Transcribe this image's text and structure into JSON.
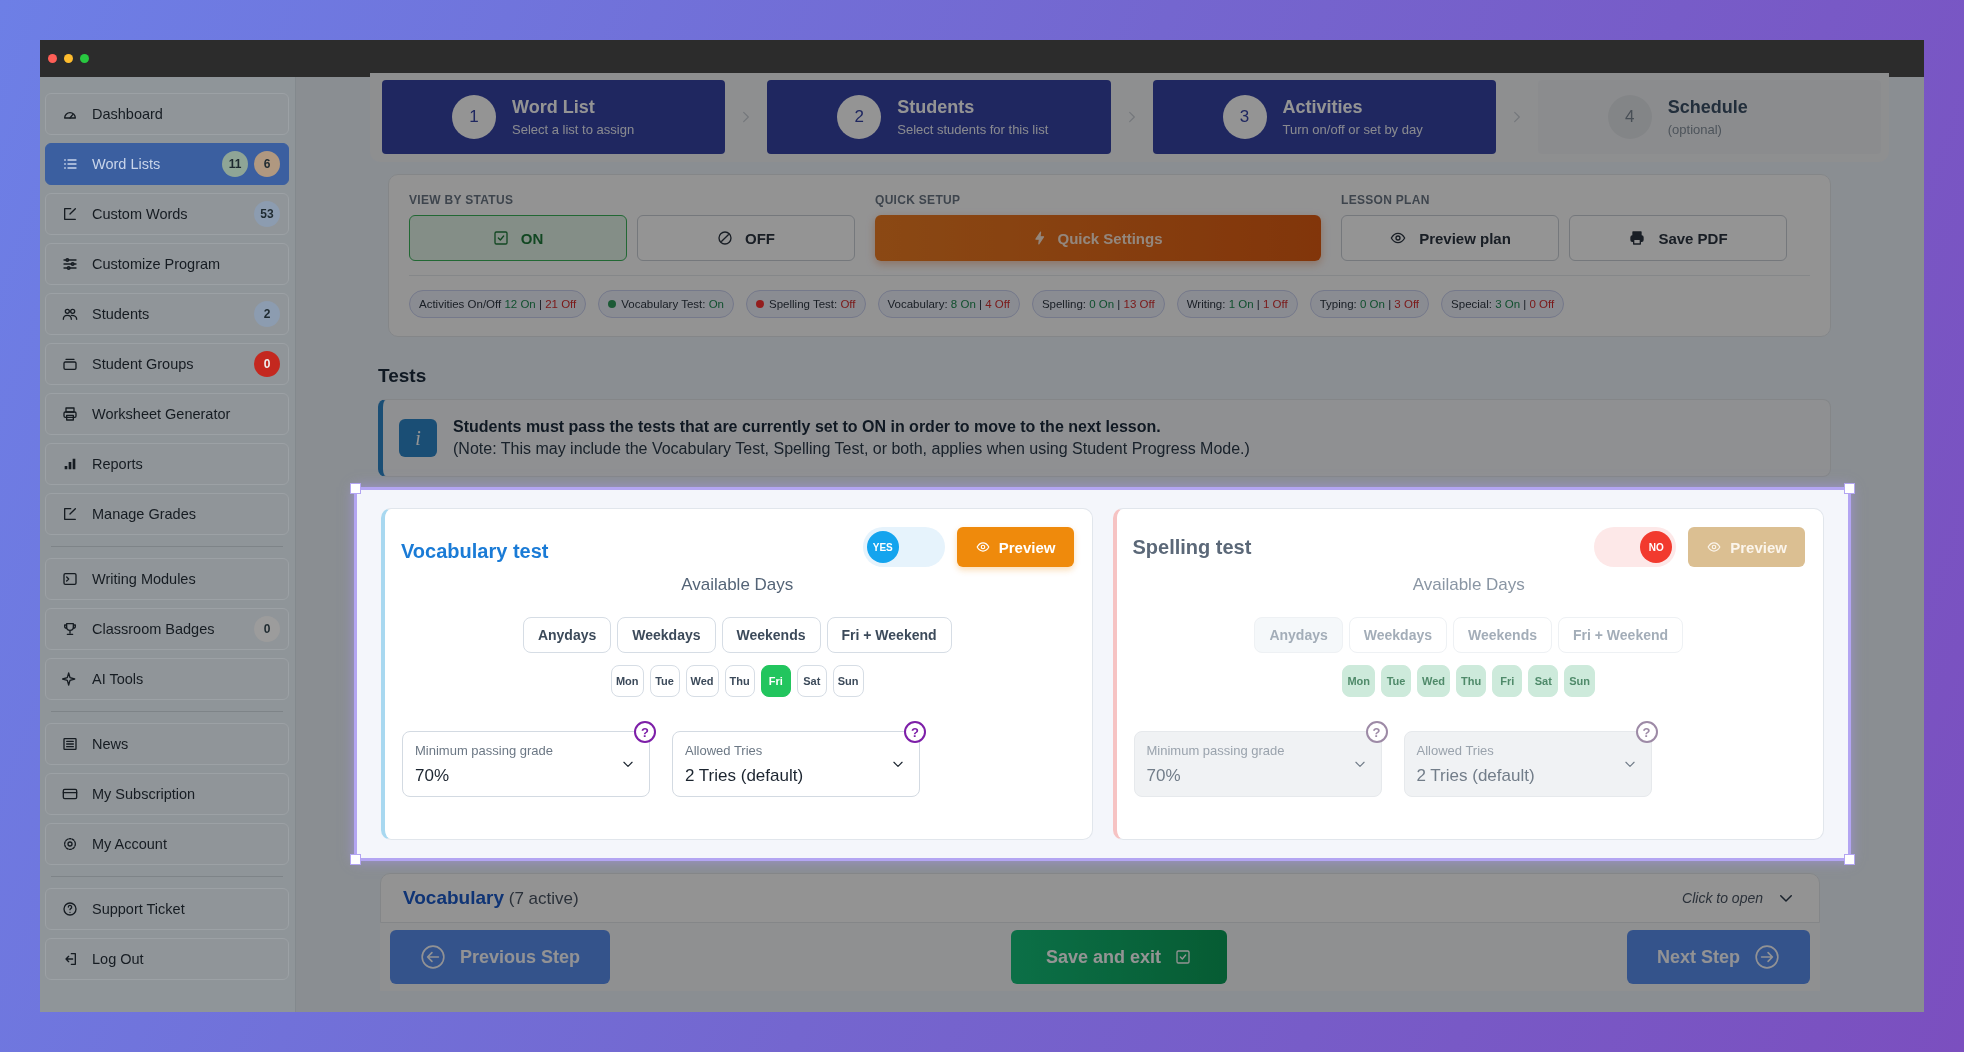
{
  "sidebar": {
    "items": [
      {
        "label": "Dashboard",
        "selected": false
      },
      {
        "label": "Word Lists",
        "selected": true,
        "badges": [
          {
            "text": "11",
            "color": "#8fa596"
          },
          {
            "text": "6",
            "color": "#b09880"
          }
        ]
      },
      {
        "label": "Custom Words",
        "selected": false,
        "badges": [
          {
            "text": "53",
            "color": "#8c9cb0"
          }
        ]
      },
      {
        "label": "Customize Program",
        "selected": false
      },
      {
        "label": "Students",
        "selected": false,
        "badges": [
          {
            "text": "2",
            "color": "#8c9cb0"
          }
        ]
      },
      {
        "label": "Student Groups",
        "selected": false,
        "badges": [
          {
            "text": "0",
            "color": "#c4281f"
          }
        ]
      },
      {
        "label": "Worksheet Generator",
        "selected": false
      },
      {
        "label": "Reports",
        "selected": false
      },
      {
        "label": "Manage Grades",
        "selected": false,
        "divider_after": true
      },
      {
        "label": "Writing Modules",
        "selected": false
      },
      {
        "label": "Classroom Badges",
        "selected": false,
        "badges": [
          {
            "text": "0",
            "color": "#9c9c9c"
          }
        ]
      },
      {
        "label": "AI Tools",
        "selected": false,
        "divider_after": true
      },
      {
        "label": "News",
        "selected": false
      },
      {
        "label": "My Subscription",
        "selected": false
      },
      {
        "label": "My Account",
        "selected": false,
        "divider_after": true
      },
      {
        "label": "Support Ticket",
        "selected": false
      },
      {
        "label": "Log Out",
        "selected": false
      }
    ]
  },
  "steps": [
    {
      "number": "1",
      "title": "Word List",
      "subtitle": "Select a list to assign",
      "active": true
    },
    {
      "number": "2",
      "title": "Students",
      "subtitle": "Select students for this list",
      "active": true
    },
    {
      "number": "3",
      "title": "Activities",
      "subtitle": "Turn on/off or set by day",
      "active": true
    },
    {
      "number": "4",
      "title": "Schedule",
      "subtitle": "(optional)",
      "active": false
    }
  ],
  "toolbar": {
    "view_by_status": {
      "heading": "VIEW BY STATUS",
      "buttons": [
        {
          "label": "ON",
          "selected": true
        },
        {
          "label": "OFF",
          "selected": false
        }
      ]
    },
    "quick_setup": {
      "heading": "QUICK SETUP",
      "button": "Quick Settings"
    },
    "lesson_plan": {
      "heading": "LESSON PLAN",
      "buttons": [
        "Preview plan",
        "Save PDF"
      ]
    },
    "chips": [
      {
        "label": "Activities On/Off",
        "parts": [
          {
            "text": "12 On",
            "kind": "on"
          },
          {
            "text": "|",
            "kind": "sep"
          },
          {
            "text": "21 Off",
            "kind": "off"
          }
        ]
      },
      {
        "label": "Vocabulary Test:",
        "color": "#1c5a36",
        "parts": [
          {
            "text": "On",
            "kind": "on"
          }
        ]
      },
      {
        "label": "Spelling Test:",
        "color": "#941e1e",
        "parts": [
          {
            "text": "Off",
            "kind": "off"
          }
        ]
      },
      {
        "label": "Vocabulary:",
        "parts": [
          {
            "text": "8 On",
            "kind": "on"
          },
          {
            "text": "|",
            "kind": "sep"
          },
          {
            "text": "4 Off",
            "kind": "off"
          }
        ]
      },
      {
        "label": "Spelling:",
        "parts": [
          {
            "text": "0 On",
            "kind": "on"
          },
          {
            "text": "|",
            "kind": "sep"
          },
          {
            "text": "13 Off",
            "kind": "off"
          }
        ]
      },
      {
        "label": "Writing:",
        "parts": [
          {
            "text": "1 On",
            "kind": "on"
          },
          {
            "text": "|",
            "kind": "sep"
          },
          {
            "text": "1 Off",
            "kind": "off"
          }
        ]
      },
      {
        "label": "Typing:",
        "parts": [
          {
            "text": "0 On",
            "kind": "on"
          },
          {
            "text": "|",
            "kind": "sep"
          },
          {
            "text": "3 Off",
            "kind": "off"
          }
        ]
      },
      {
        "label": "Special:",
        "parts": [
          {
            "text": "3 On",
            "kind": "on"
          },
          {
            "text": "|",
            "kind": "sep"
          },
          {
            "text": "0 Off",
            "kind": "off"
          }
        ]
      }
    ]
  },
  "tests": {
    "heading": "Tests",
    "info_icon": "i",
    "info_text": "Students must pass the tests that are currently set to ON in order to move to the next lesson.",
    "info_note": "(Note: This may include the Vocabulary Test, Spelling Test, or both, applies when using Student Progress Mode.)",
    "cards": [
      {
        "title": "Vocabulary test",
        "on": true,
        "toggle_label": "YES",
        "preview": "Preview",
        "days_title": "Available Days",
        "presets": [
          "Anydays",
          "Weekdays",
          "Weekends",
          "Fri + Weekend"
        ],
        "days": [
          {
            "label": "Mon",
            "selected": false
          },
          {
            "label": "Tue",
            "selected": false
          },
          {
            "label": "Wed",
            "selected": false
          },
          {
            "label": "Thu",
            "selected": false
          },
          {
            "label": "Fri",
            "selected": true
          },
          {
            "label": "Sat",
            "selected": false
          },
          {
            "label": "Sun",
            "selected": false
          }
        ],
        "selects": [
          {
            "label": "Minimum passing grade",
            "value": "70%",
            "help": "?"
          },
          {
            "label": "Allowed Tries",
            "value": "2 Tries (default)",
            "help": "?"
          }
        ]
      },
      {
        "title": "Spelling test",
        "on": false,
        "toggle_label": "NO",
        "preview": "Preview",
        "days_title": "Available Days",
        "presets": [
          "Anydays",
          "Weekdays",
          "Weekends",
          "Fri + Weekend"
        ],
        "days": [
          {
            "label": "Mon",
            "selected": true
          },
          {
            "label": "Tue",
            "selected": true
          },
          {
            "label": "Wed",
            "selected": true
          },
          {
            "label": "Thu",
            "selected": true
          },
          {
            "label": "Fri",
            "selected": true
          },
          {
            "label": "Sat",
            "selected": true
          },
          {
            "label": "Sun",
            "selected": true
          }
        ],
        "selects": [
          {
            "label": "Minimum passing grade",
            "value": "70%",
            "help": "?"
          },
          {
            "label": "Allowed Tries",
            "value": "2 Tries (default)",
            "help": "?"
          }
        ]
      }
    ]
  },
  "section": {
    "title": "Vocabulary",
    "count": "(7 active)",
    "hint": "Click to open",
    "expanded": false
  },
  "footer": {
    "previous": "Previous Step",
    "save": "Save and exit",
    "next": "Next Step"
  }
}
